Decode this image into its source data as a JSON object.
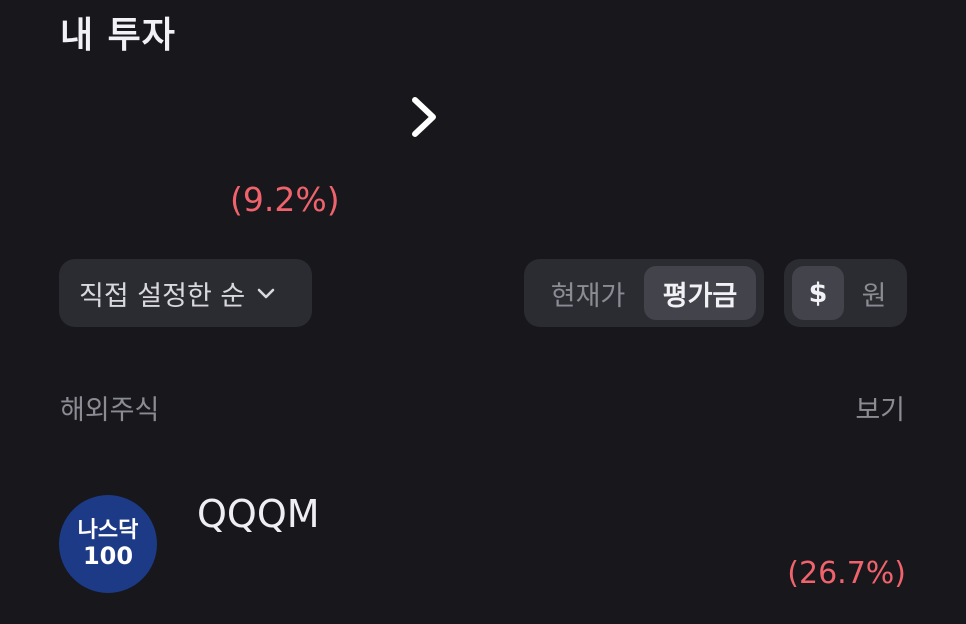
{
  "header": {
    "title": "내 투자"
  },
  "summary": {
    "total_change": "(9.2%)"
  },
  "controls": {
    "sort_label": "직접 설정한 순",
    "price_toggle": {
      "options": [
        "현재가",
        "평가금"
      ],
      "selected": "평가금"
    },
    "currency_toggle": {
      "options": [
        "$",
        "원"
      ],
      "selected": "$"
    }
  },
  "section": {
    "label": "해외주식",
    "view_label": "보기"
  },
  "holdings": [
    {
      "logo_line1": "나스닥",
      "logo_line2": "100",
      "name": "QQQM",
      "change": "(26.7%)"
    }
  ],
  "colors": {
    "background": "#17171c",
    "surface": "#2b2b32",
    "active_segment": "#43434b",
    "loss_red": "#f0636c",
    "logo_blue": "#1d3a86"
  },
  "icons": {
    "detail": "chevron-right-icon",
    "sort": "chevron-down-icon"
  }
}
